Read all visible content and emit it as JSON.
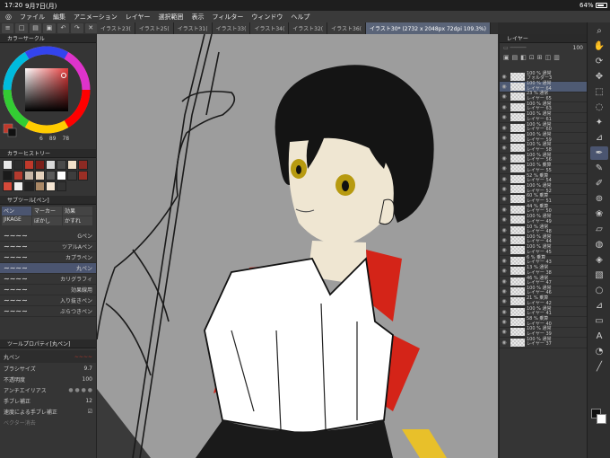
{
  "status": {
    "time": "17:20",
    "date": "9月7日(月)",
    "battery": "64%"
  },
  "menu": [
    "ファイル",
    "編集",
    "アニメーション",
    "レイヤー",
    "選択範囲",
    "表示",
    "フィルター",
    "ウィンドウ",
    "ヘルプ"
  ],
  "tabs": [
    "イラスト23(",
    "イラスト25(",
    "イラスト31(",
    "イラスト33(",
    "イラスト34(",
    "イラスト32(",
    "イラスト36(",
    "イラスト30* (2732 x 2048px 72dpi 109.3%)"
  ],
  "colorcircle": {
    "title": "カラーサークル",
    "values": [
      "6",
      "89",
      "78"
    ]
  },
  "colorhistory": {
    "title": "カラーヒストリー",
    "swatches": [
      "#e8e8e8",
      "#2b2b2b",
      "#c0392b",
      "#7a1f1a",
      "#d9d9d9",
      "#4a4a4a",
      "#f2e0c9",
      "#8c2a23",
      "#1a1a1a",
      "#b33a2e",
      "#c8b6a6",
      "#e6d2bd",
      "#5a5a5a",
      "#ffffff",
      "#3d3d3d",
      "#9a2f25",
      "#d64a3a",
      "#efefef",
      "#222222",
      "#aa8866",
      "#f5e6d3",
      "#333333"
    ]
  },
  "subtool": {
    "title": "サブツール[ペン]",
    "tabs": [
      "ペン",
      "マーカー",
      "効果",
      "JIKAGE",
      "ぼかし",
      "かすれ"
    ],
    "brushes": [
      "Gペン",
      "ツアルAペン",
      "カプラペン",
      "丸ペン",
      "カリグラフィ",
      "効果線用",
      "入り抜きペン",
      "ぶらつきペン"
    ],
    "selected": 3
  },
  "toolprop": {
    "title": "ツールプロパティ[丸ペン]",
    "brushname": "丸ペン",
    "size_label": "ブラシサイズ",
    "size": "9.7",
    "opacity_label": "不透明度",
    "opacity": "100",
    "aa_label": "アンチエイリアス",
    "correction_label": "手ブレ補正",
    "correction": "12",
    "speed_label": "速度による手ブレ補正",
    "vector_label": "ベクター消去"
  },
  "layers": {
    "title": "レイヤー",
    "opacity": "100",
    "items": [
      {
        "mode": "100 % 通常",
        "name": "フォルダー3",
        "folder": true
      },
      {
        "mode": "100 % 通常",
        "name": "レイヤー 64",
        "selected": true
      },
      {
        "mode": "23 % 通常",
        "name": "レイヤー 65"
      },
      {
        "mode": "100 % 通常",
        "name": "レイヤー 63"
      },
      {
        "mode": "100 % 通常",
        "name": "レイヤー 61"
      },
      {
        "mode": "100 % 通常",
        "name": "レイヤー 60"
      },
      {
        "mode": "100 % 通常",
        "name": "レイヤー 59"
      },
      {
        "mode": "100 % 通常",
        "name": "レイヤー 58"
      },
      {
        "mode": "100 % 通常",
        "name": "レイヤー 56"
      },
      {
        "mode": "100 % 乗算",
        "name": "レイヤー 55"
      },
      {
        "mode": "52 % 乗算",
        "name": "レイヤー 54"
      },
      {
        "mode": "100 % 通常",
        "name": "レイヤー 52"
      },
      {
        "mode": "60 % 乗算",
        "name": "レイヤー 51"
      },
      {
        "mode": "44 % 乗算",
        "name": "レイヤー 50"
      },
      {
        "mode": "100 % 通常",
        "name": "レイヤー 49"
      },
      {
        "mode": "10 % 通常",
        "name": "レイヤー 48"
      },
      {
        "mode": "100 % 通常",
        "name": "レイヤー 44"
      },
      {
        "mode": "100 % 通常",
        "name": "レイヤー 45"
      },
      {
        "mode": "6 % 乗算",
        "name": "レイヤー 43"
      },
      {
        "mode": "13 % 通常",
        "name": "レイヤー 38"
      },
      {
        "mode": "46 % 通常",
        "name": "レイヤー 47"
      },
      {
        "mode": "100 % 通常",
        "name": "レイヤー 46"
      },
      {
        "mode": "21 % 乗算",
        "name": "レイヤー 42"
      },
      {
        "mode": "100 % 通常",
        "name": "レイヤー 41"
      },
      {
        "mode": "58 % 乗算",
        "name": "レイヤー 40"
      },
      {
        "mode": "100 % 通常",
        "name": "レイヤー 39"
      },
      {
        "mode": "100 % 通常",
        "name": "レイヤー 37"
      }
    ]
  },
  "tools": [
    "zoom-icon",
    "hand-icon",
    "rotate-icon",
    "move-icon",
    "select-icon",
    "lasso-icon",
    "wand-icon",
    "eyedropper-icon",
    "pen-icon",
    "pencil-icon",
    "brush-icon",
    "airbrush-icon",
    "decoration-icon",
    "eraser-icon",
    "blend-icon",
    "fill-icon",
    "gradient-icon",
    "figure-icon",
    "ruler-icon",
    "frame-icon",
    "text-icon",
    "balloon-icon",
    "line-icon"
  ]
}
